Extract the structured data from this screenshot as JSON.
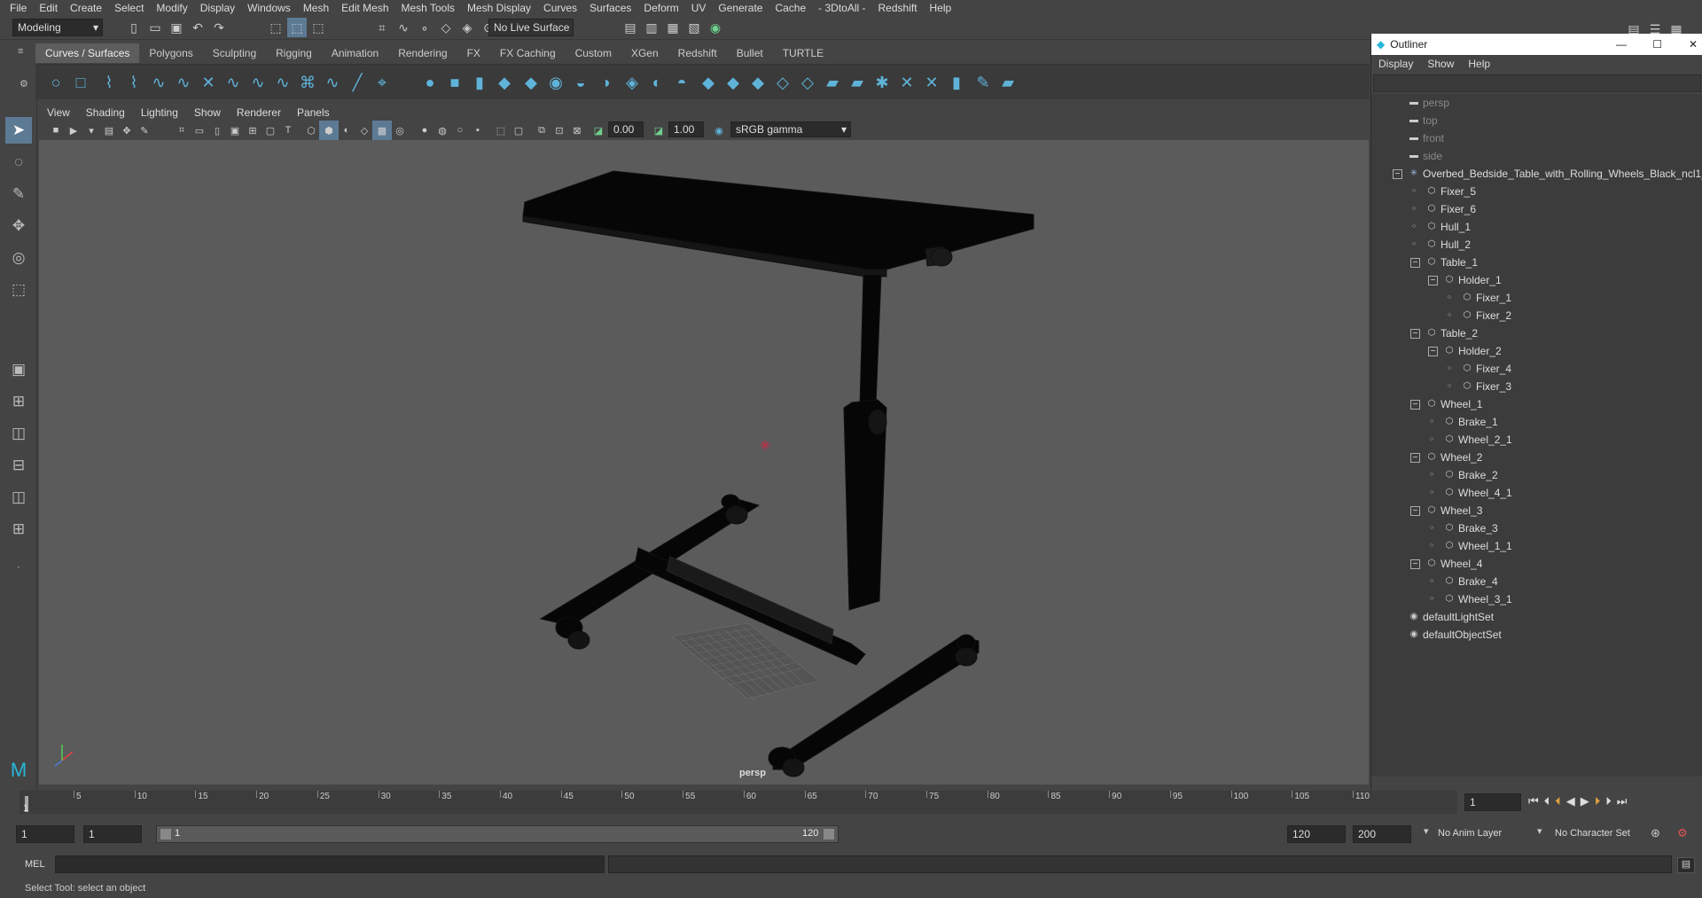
{
  "menubar": {
    "items": [
      "File",
      "Edit",
      "Create",
      "Select",
      "Modify",
      "Display",
      "Windows",
      "Mesh",
      "Edit Mesh",
      "Mesh Tools",
      "Mesh Display",
      "Curves",
      "Surfaces",
      "Deform",
      "UV",
      "Generate",
      "Cache",
      "- 3DtoAll -",
      "Redshift",
      "Help"
    ]
  },
  "status": {
    "mode": "Modeling",
    "live_surface": "No Live Surface"
  },
  "shelf": {
    "tabs": [
      "Curves / Surfaces",
      "Polygons",
      "Sculpting",
      "Rigging",
      "Animation",
      "Rendering",
      "FX",
      "FX Caching",
      "Custom",
      "XGen",
      "Redshift",
      "Bullet",
      "TURTLE"
    ],
    "active": "Curves / Surfaces"
  },
  "panel": {
    "menus": [
      "View",
      "Shading",
      "Lighting",
      "Show",
      "Renderer",
      "Panels"
    ],
    "exposure": "0.00",
    "gamma": "1.00",
    "color_space": "sRGB gamma",
    "camera_label": "persp"
  },
  "outliner": {
    "title": "Outliner",
    "menus": [
      "Display",
      "Show",
      "Help"
    ],
    "items": [
      {
        "label": "persp",
        "depth": 0,
        "icon": "camera-icon",
        "dim": true,
        "toggle": ""
      },
      {
        "label": "top",
        "depth": 0,
        "icon": "camera-icon",
        "dim": true,
        "toggle": ""
      },
      {
        "label": "front",
        "depth": 0,
        "icon": "camera-icon",
        "dim": true,
        "toggle": ""
      },
      {
        "label": "side",
        "depth": 0,
        "icon": "camera-icon",
        "dim": true,
        "toggle": ""
      },
      {
        "label": "Overbed_Bedside_Table_with_Rolling_Wheels_Black_ncl1_1",
        "depth": 0,
        "icon": "group-icon",
        "toggle": "−"
      },
      {
        "label": "Fixer_5",
        "depth": 1,
        "icon": "mesh-icon",
        "toggle": ""
      },
      {
        "label": "Fixer_6",
        "depth": 1,
        "icon": "mesh-icon",
        "toggle": ""
      },
      {
        "label": "Hull_1",
        "depth": 1,
        "icon": "mesh-icon",
        "toggle": ""
      },
      {
        "label": "Hull_2",
        "depth": 1,
        "icon": "mesh-icon",
        "toggle": ""
      },
      {
        "label": "Table_1",
        "depth": 1,
        "icon": "mesh-icon",
        "toggle": "−"
      },
      {
        "label": "Holder_1",
        "depth": 2,
        "icon": "mesh-icon",
        "toggle": "−"
      },
      {
        "label": "Fixer_1",
        "depth": 3,
        "icon": "mesh-icon",
        "toggle": ""
      },
      {
        "label": "Fixer_2",
        "depth": 3,
        "icon": "mesh-icon",
        "toggle": ""
      },
      {
        "label": "Table_2",
        "depth": 1,
        "icon": "mesh-icon",
        "toggle": "−"
      },
      {
        "label": "Holder_2",
        "depth": 2,
        "icon": "mesh-icon",
        "toggle": "−"
      },
      {
        "label": "Fixer_4",
        "depth": 3,
        "icon": "mesh-icon",
        "toggle": ""
      },
      {
        "label": "Fixer_3",
        "depth": 3,
        "icon": "mesh-icon",
        "toggle": ""
      },
      {
        "label": "Wheel_1",
        "depth": 1,
        "icon": "mesh-icon",
        "toggle": "−"
      },
      {
        "label": "Brake_1",
        "depth": 2,
        "icon": "mesh-icon",
        "toggle": ""
      },
      {
        "label": "Wheel_2_1",
        "depth": 2,
        "icon": "mesh-icon",
        "toggle": ""
      },
      {
        "label": "Wheel_2",
        "depth": 1,
        "icon": "mesh-icon",
        "toggle": "−"
      },
      {
        "label": "Brake_2",
        "depth": 2,
        "icon": "mesh-icon",
        "toggle": ""
      },
      {
        "label": "Wheel_4_1",
        "depth": 2,
        "icon": "mesh-icon",
        "toggle": ""
      },
      {
        "label": "Wheel_3",
        "depth": 1,
        "icon": "mesh-icon",
        "toggle": "−"
      },
      {
        "label": "Brake_3",
        "depth": 2,
        "icon": "mesh-icon",
        "toggle": ""
      },
      {
        "label": "Wheel_1_1",
        "depth": 2,
        "icon": "mesh-icon",
        "toggle": ""
      },
      {
        "label": "Wheel_4",
        "depth": 1,
        "icon": "mesh-icon",
        "toggle": "−"
      },
      {
        "label": "Brake_4",
        "depth": 2,
        "icon": "mesh-icon",
        "toggle": ""
      },
      {
        "label": "Wheel_3_1",
        "depth": 2,
        "icon": "mesh-icon",
        "toggle": ""
      },
      {
        "label": "defaultLightSet",
        "depth": 0,
        "icon": "set-icon",
        "toggle": ""
      },
      {
        "label": "defaultObjectSet",
        "depth": 0,
        "icon": "set-icon",
        "toggle": ""
      }
    ]
  },
  "timeline": {
    "ticks": [
      "5",
      "10",
      "15",
      "20",
      "25",
      "30",
      "35",
      "40",
      "45",
      "50",
      "55",
      "60",
      "65",
      "70",
      "75",
      "80",
      "85",
      "90",
      "95",
      "100",
      "105",
      "110"
    ],
    "first_tick": "1",
    "current_frame": "1"
  },
  "range": {
    "start": "1",
    "playback_start": "1",
    "slider_start": "1",
    "slider_end": "120",
    "playback_end": "120",
    "end": "200",
    "anim_layer": "No Anim Layer",
    "character_set": "No Character Set"
  },
  "cmd": {
    "label": "MEL"
  },
  "help": {
    "text": "Select Tool: select an object"
  },
  "colors": {
    "accent": "#5fb3d9",
    "bg": "#444444",
    "viewport": "#5b5b5b"
  }
}
